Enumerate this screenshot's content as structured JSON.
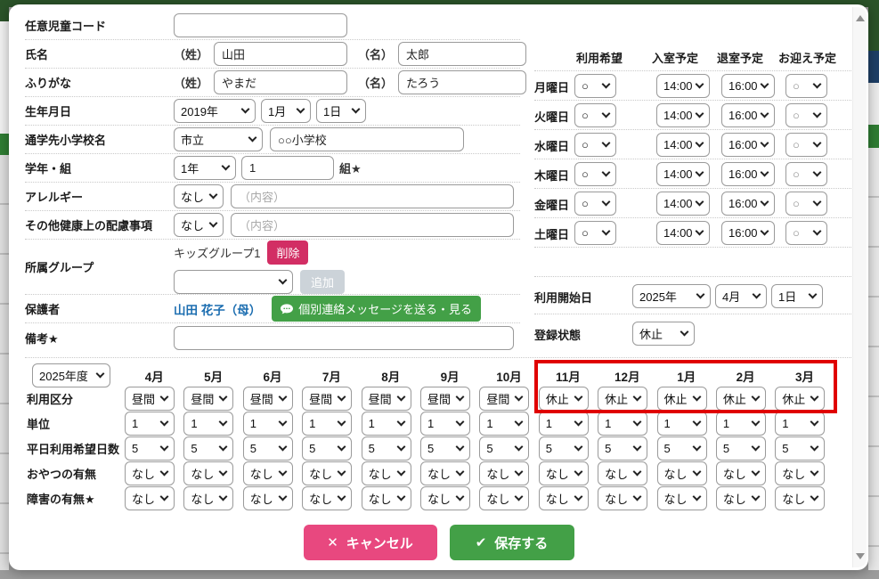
{
  "form": {
    "code": {
      "label": "任意児童コード",
      "value": ""
    },
    "name": {
      "label": "氏名",
      "sei_prefix": "（姓）",
      "sei": "山田",
      "mei_prefix": "（名）",
      "mei": "太郎"
    },
    "kana": {
      "label": "ふりがな",
      "sei_prefix": "（姓）",
      "sei": "やまだ",
      "mei_prefix": "（名）",
      "mei": "たろう"
    },
    "birth": {
      "label": "生年月日",
      "year": "2019年",
      "month": "1月",
      "day": "1日"
    },
    "school": {
      "label": "通学先小学校名",
      "type": "市立",
      "name": "○○小学校"
    },
    "grade": {
      "label": "学年・組",
      "grade": "1年",
      "class_value": "1",
      "class_suffix": "組★"
    },
    "allergy": {
      "label": "アレルギー",
      "value": "なし",
      "placeholder": "（内容）"
    },
    "health": {
      "label": "その他健康上の配慮事項",
      "value": "なし",
      "placeholder": "（内容）"
    },
    "group": {
      "label": "所属グループ",
      "member": "キッズグループ1",
      "delete_label": "削除",
      "add_label": "追加",
      "select_value": ""
    },
    "guardian": {
      "label": "保護者",
      "name": "山田 花子（母）",
      "message_label": "個別連絡メッセージを送る・見る"
    },
    "note": {
      "label": "備考★",
      "value": ""
    }
  },
  "weekly": {
    "col_headers": [
      "利用希望",
      "入室予定",
      "退室予定",
      "お迎え予定"
    ],
    "days": [
      "月曜日",
      "火曜日",
      "水曜日",
      "木曜日",
      "金曜日",
      "土曜日"
    ],
    "use_value": "○",
    "entry_value": "14:00",
    "exit_value": "16:00",
    "pickup_value": "○"
  },
  "start_date": {
    "label": "利用開始日",
    "year": "2025年",
    "month": "4月",
    "day": "1日"
  },
  "reg_status": {
    "label": "登録状態",
    "value": "休止"
  },
  "monthly": {
    "year_label": "2025年度",
    "months": [
      "4月",
      "5月",
      "6月",
      "7月",
      "8月",
      "9月",
      "10月",
      "11月",
      "12月",
      "1月",
      "2月",
      "3月"
    ],
    "rows": [
      {
        "label": "利用区分",
        "values": [
          "昼間",
          "昼間",
          "昼間",
          "昼間",
          "昼間",
          "昼間",
          "昼間",
          "休止",
          "休止",
          "休止",
          "休止",
          "休止"
        ]
      },
      {
        "label": "単位",
        "values": [
          "1",
          "1",
          "1",
          "1",
          "1",
          "1",
          "1",
          "1",
          "1",
          "1",
          "1",
          "1"
        ]
      },
      {
        "label": "平日利用希望日数",
        "values": [
          "5",
          "5",
          "5",
          "5",
          "5",
          "5",
          "5",
          "5",
          "5",
          "5",
          "5",
          "5"
        ]
      },
      {
        "label": "おやつの有無",
        "values": [
          "なし",
          "なし",
          "なし",
          "なし",
          "なし",
          "なし",
          "なし",
          "なし",
          "なし",
          "なし",
          "なし",
          "なし"
        ]
      },
      {
        "label": "障害の有無★",
        "values": [
          "なし",
          "なし",
          "なし",
          "なし",
          "なし",
          "なし",
          "なし",
          "なし",
          "なし",
          "なし",
          "なし",
          "なし"
        ]
      }
    ],
    "highlight_start_month": "11月",
    "highlight_end_month": "3月"
  },
  "actions": {
    "cancel": "キャンセル",
    "save": "保存する",
    "cancel_icon": "✕",
    "save_icon": "✔"
  },
  "colors": {
    "highlight_red": "#e00000",
    "save_green": "#43a047",
    "cancel_pink": "#e8487f",
    "delete_pink": "#d22e64",
    "add_gray": "#ccd3d9",
    "link_blue": "#1b6db0",
    "header_green": "#2b5329"
  }
}
